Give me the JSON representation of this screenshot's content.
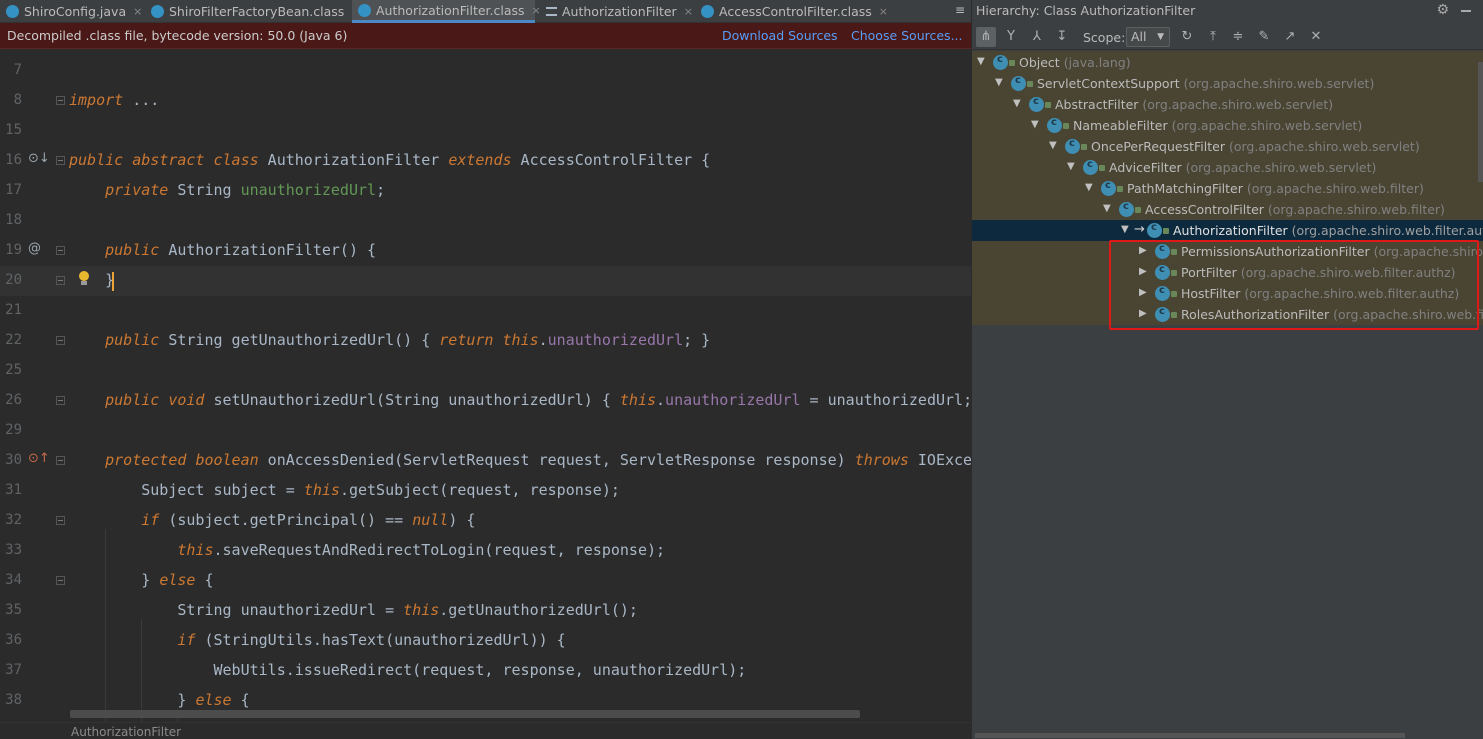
{
  "tabs": [
    {
      "label": "ShiroConfig.java",
      "icon": "java-class-icon",
      "active": false
    },
    {
      "label": "ShiroFilterFactoryBean.class",
      "icon": "class-icon",
      "active": false
    },
    {
      "label": "AuthorizationFilter.class",
      "icon": "class-icon",
      "active": true
    },
    {
      "label": "AuthorizationFilter",
      "icon": "structure-icon",
      "active": false
    },
    {
      "label": "AccessControlFilter.class",
      "icon": "class-icon",
      "active": false
    }
  ],
  "tab_close_glyph": "×",
  "tab_menu_glyph": "≡",
  "banner": {
    "text": "Decompiled .class file, bytecode version: 50.0 (Java 6)",
    "download_sources": "Download Sources",
    "choose_sources": "Choose Sources..."
  },
  "code_lines": [
    {
      "num": "7",
      "text": ""
    },
    {
      "num": "8",
      "text": "import ..."
    },
    {
      "num": "15",
      "text": ""
    },
    {
      "num": "16",
      "text": "public abstract class AuthorizationFilter extends AccessControlFilter {"
    },
    {
      "num": "17",
      "text": "    private String unauthorizedUrl;"
    },
    {
      "num": "18",
      "text": ""
    },
    {
      "num": "19",
      "text": "    public AuthorizationFilter() {"
    },
    {
      "num": "20",
      "text": "    }"
    },
    {
      "num": "21",
      "text": ""
    },
    {
      "num": "22",
      "text": "    public String getUnauthorizedUrl() { return this.unauthorizedUrl; }"
    },
    {
      "num": "25",
      "text": ""
    },
    {
      "num": "26",
      "text": "    public void setUnauthorizedUrl(String unauthorizedUrl) { this.unauthorizedUrl = unauthorizedUrl;"
    },
    {
      "num": "29",
      "text": ""
    },
    {
      "num": "30",
      "text": "    protected boolean onAccessDenied(ServletRequest request, ServletResponse response) throws IOExcep"
    },
    {
      "num": "31",
      "text": "        Subject subject = this.getSubject(request, response);"
    },
    {
      "num": "32",
      "text": "        if (subject.getPrincipal() == null) {"
    },
    {
      "num": "33",
      "text": "            this.saveRequestAndRedirectToLogin(request, response);"
    },
    {
      "num": "34",
      "text": "        } else {"
    },
    {
      "num": "35",
      "text": "            String unauthorizedUrl = this.getUnauthorizedUrl();"
    },
    {
      "num": "36",
      "text": "            if (StringUtils.hasText(unauthorizedUrl)) {"
    },
    {
      "num": "37",
      "text": "                WebUtils.issueRedirect(request, response, unauthorizedUrl);"
    },
    {
      "num": "38",
      "text": "            } else {"
    }
  ],
  "gutter_marks": {
    "line16": "⊙↓",
    "line19": "@",
    "line30": "⊙↑"
  },
  "breadcrumb": "AuthorizationFilter",
  "hierarchy": {
    "title": "Hierarchy:  Class AuthorizationFilter",
    "scope_label": "Scope:",
    "scope_value": "All",
    "toolbar_icons": [
      "class-hierarchy-icon",
      "supertypes-icon",
      "subtypes-icon",
      "refresh-icon",
      "export-icon",
      "expand-all-icon",
      "pin-icon",
      "open-in-editor-icon",
      "close-icon"
    ],
    "tree": [
      {
        "name": "Object",
        "pkg": " (java.lang)",
        "depth": 0,
        "arrow": "▼",
        "selected": false
      },
      {
        "name": "ServletContextSupport",
        "pkg": " (org.apache.shiro.web.servlet)",
        "depth": 1,
        "arrow": "▼",
        "selected": false
      },
      {
        "name": "AbstractFilter",
        "pkg": " (org.apache.shiro.web.servlet)",
        "depth": 2,
        "arrow": "▼",
        "selected": false
      },
      {
        "name": "NameableFilter",
        "pkg": " (org.apache.shiro.web.servlet)",
        "depth": 3,
        "arrow": "▼",
        "selected": false
      },
      {
        "name": "OncePerRequestFilter",
        "pkg": " (org.apache.shiro.web.servlet)",
        "depth": 4,
        "arrow": "▼",
        "selected": false
      },
      {
        "name": "AdviceFilter",
        "pkg": " (org.apache.shiro.web.servlet)",
        "depth": 5,
        "arrow": "▼",
        "selected": false
      },
      {
        "name": "PathMatchingFilter",
        "pkg": " (org.apache.shiro.web.filter)",
        "depth": 6,
        "arrow": "▼",
        "selected": false
      },
      {
        "name": "AccessControlFilter",
        "pkg": " (org.apache.shiro.web.filter)",
        "depth": 7,
        "arrow": "▼",
        "selected": false
      },
      {
        "name": "AuthorizationFilter",
        "pkg": " (org.apache.shiro.web.filter.authz)",
        "depth": 8,
        "arrow": "▼",
        "selected": true
      },
      {
        "name": "PermissionsAuthorizationFilter",
        "pkg": " (org.apache.shiro.w",
        "depth": 9,
        "arrow": "▶",
        "selected": false
      },
      {
        "name": "PortFilter",
        "pkg": " (org.apache.shiro.web.filter.authz)",
        "depth": 9,
        "arrow": "▶",
        "selected": false
      },
      {
        "name": "HostFilter",
        "pkg": " (org.apache.shiro.web.filter.authz)",
        "depth": 9,
        "arrow": "▶",
        "selected": false
      },
      {
        "name": "RolesAuthorizationFilter",
        "pkg": " (org.apache.shiro.web.filt",
        "depth": 9,
        "arrow": "▶",
        "selected": false
      }
    ]
  },
  "colors": {
    "keyword": "#cc7832",
    "field": "#9876aa",
    "highlight_field": "#629755",
    "banner_bg": "#4b1818",
    "tree_bg": "#4a4533",
    "selection_bg": "#0d293e",
    "annotation_box": "#e01818"
  }
}
